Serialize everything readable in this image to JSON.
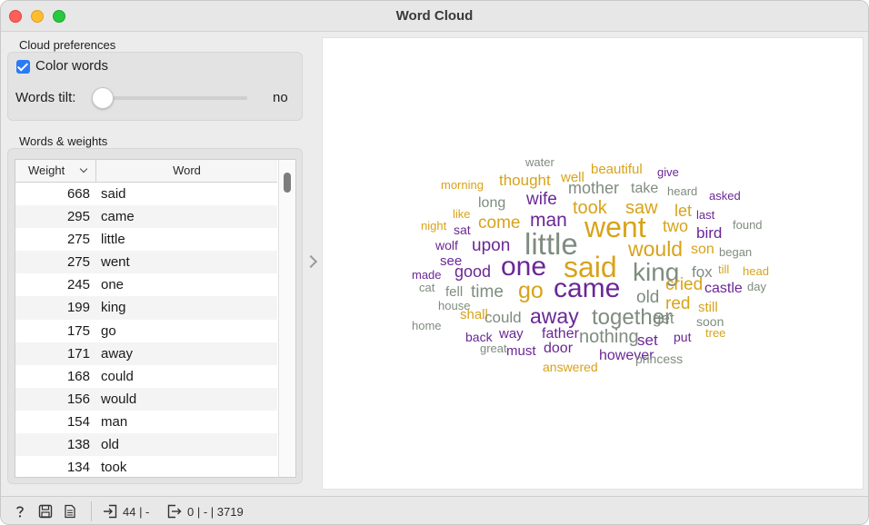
{
  "window": {
    "title": "Word Cloud"
  },
  "preferences": {
    "heading": "Cloud preferences",
    "color_words_label": "Color words",
    "color_words_checked": true,
    "tilt_label": "Words tilt:",
    "tilt_value": "no",
    "tilt_level": 0
  },
  "words_table": {
    "heading": "Words & weights",
    "col_weight": "Weight",
    "col_word": "Word",
    "rows": [
      {
        "weight": "668",
        "word": "said"
      },
      {
        "weight": "295",
        "word": "came"
      },
      {
        "weight": "275",
        "word": "little"
      },
      {
        "weight": "275",
        "word": "went"
      },
      {
        "weight": "245",
        "word": "one"
      },
      {
        "weight": "199",
        "word": "king"
      },
      {
        "weight": "175",
        "word": "go"
      },
      {
        "weight": "171",
        "word": "away"
      },
      {
        "weight": "168",
        "word": "could"
      },
      {
        "weight": "156",
        "word": "would"
      },
      {
        "weight": "154",
        "word": "man"
      },
      {
        "weight": "138",
        "word": "old"
      },
      {
        "weight": "134",
        "word": "took"
      }
    ]
  },
  "palette": {
    "gold": "#d8a31a",
    "purple": "#6a2796",
    "gray": "#7f8c7f"
  },
  "cloud_words": [
    {
      "text": "water",
      "color": "gray"
    },
    {
      "text": "beautiful",
      "color": "gold"
    },
    {
      "text": "give",
      "color": "purple"
    },
    {
      "text": "morning",
      "color": "gold"
    },
    {
      "text": "thought",
      "color": "gold"
    },
    {
      "text": "well",
      "color": "gold"
    },
    {
      "text": "heard",
      "color": "gray"
    },
    {
      "text": "asked",
      "color": "purple"
    },
    {
      "text": "mother",
      "color": "gray"
    },
    {
      "text": "take",
      "color": "gray"
    },
    {
      "text": "wife",
      "color": "purple"
    },
    {
      "text": "long",
      "color": "gray"
    },
    {
      "text": "like",
      "color": "gold"
    },
    {
      "text": "took",
      "color": "gold"
    },
    {
      "text": "saw",
      "color": "gold"
    },
    {
      "text": "let",
      "color": "gold"
    },
    {
      "text": "last",
      "color": "purple"
    },
    {
      "text": "man",
      "color": "purple"
    },
    {
      "text": "went",
      "color": "gold"
    },
    {
      "text": "two",
      "color": "gold"
    },
    {
      "text": "come",
      "color": "gold"
    },
    {
      "text": "found",
      "color": "gray"
    },
    {
      "text": "night",
      "color": "gold"
    },
    {
      "text": "sat",
      "color": "purple"
    },
    {
      "text": "bird",
      "color": "purple"
    },
    {
      "text": "little",
      "color": "gray"
    },
    {
      "text": "wolf",
      "color": "purple"
    },
    {
      "text": "upon",
      "color": "purple"
    },
    {
      "text": "would",
      "color": "gold"
    },
    {
      "text": "son",
      "color": "gold"
    },
    {
      "text": "began",
      "color": "gray"
    },
    {
      "text": "see",
      "color": "purple"
    },
    {
      "text": "one",
      "color": "purple"
    },
    {
      "text": "said",
      "color": "gold"
    },
    {
      "text": "till",
      "color": "gold"
    },
    {
      "text": "made",
      "color": "purple"
    },
    {
      "text": "good",
      "color": "purple"
    },
    {
      "text": "king",
      "color": "gray"
    },
    {
      "text": "fox",
      "color": "gray"
    },
    {
      "text": "head",
      "color": "gold"
    },
    {
      "text": "cat",
      "color": "gray"
    },
    {
      "text": "fell",
      "color": "gray"
    },
    {
      "text": "time",
      "color": "gray"
    },
    {
      "text": "go",
      "color": "gold"
    },
    {
      "text": "came",
      "color": "purple"
    },
    {
      "text": "old",
      "color": "gray"
    },
    {
      "text": "cried",
      "color": "gold"
    },
    {
      "text": "castle",
      "color": "purple"
    },
    {
      "text": "day",
      "color": "gray"
    },
    {
      "text": "red",
      "color": "gold"
    },
    {
      "text": "house",
      "color": "gray"
    },
    {
      "text": "still",
      "color": "gold"
    },
    {
      "text": "shall",
      "color": "gold"
    },
    {
      "text": "could",
      "color": "gray"
    },
    {
      "text": "away",
      "color": "purple"
    },
    {
      "text": "together",
      "color": "gray"
    },
    {
      "text": "home",
      "color": "gray"
    },
    {
      "text": "get",
      "color": "gray"
    },
    {
      "text": "soon",
      "color": "gray"
    },
    {
      "text": "way",
      "color": "purple"
    },
    {
      "text": "father",
      "color": "purple"
    },
    {
      "text": "nothing",
      "color": "gray"
    },
    {
      "text": "tree",
      "color": "gold"
    },
    {
      "text": "back",
      "color": "purple"
    },
    {
      "text": "set",
      "color": "purple"
    },
    {
      "text": "put",
      "color": "purple"
    },
    {
      "text": "great",
      "color": "gray"
    },
    {
      "text": "must",
      "color": "purple"
    },
    {
      "text": "door",
      "color": "purple"
    },
    {
      "text": "however",
      "color": "purple"
    },
    {
      "text": "princess",
      "color": "gray"
    },
    {
      "text": "answered",
      "color": "gold"
    }
  ],
  "statusbar": {
    "input_text": "44 | -",
    "output_text": "0 | - | 3719"
  },
  "icons": {
    "help": "help-icon",
    "save": "save-icon",
    "report": "report-icon",
    "input": "input-icon",
    "output": "output-icon",
    "collapse": "chevron-right-icon"
  }
}
